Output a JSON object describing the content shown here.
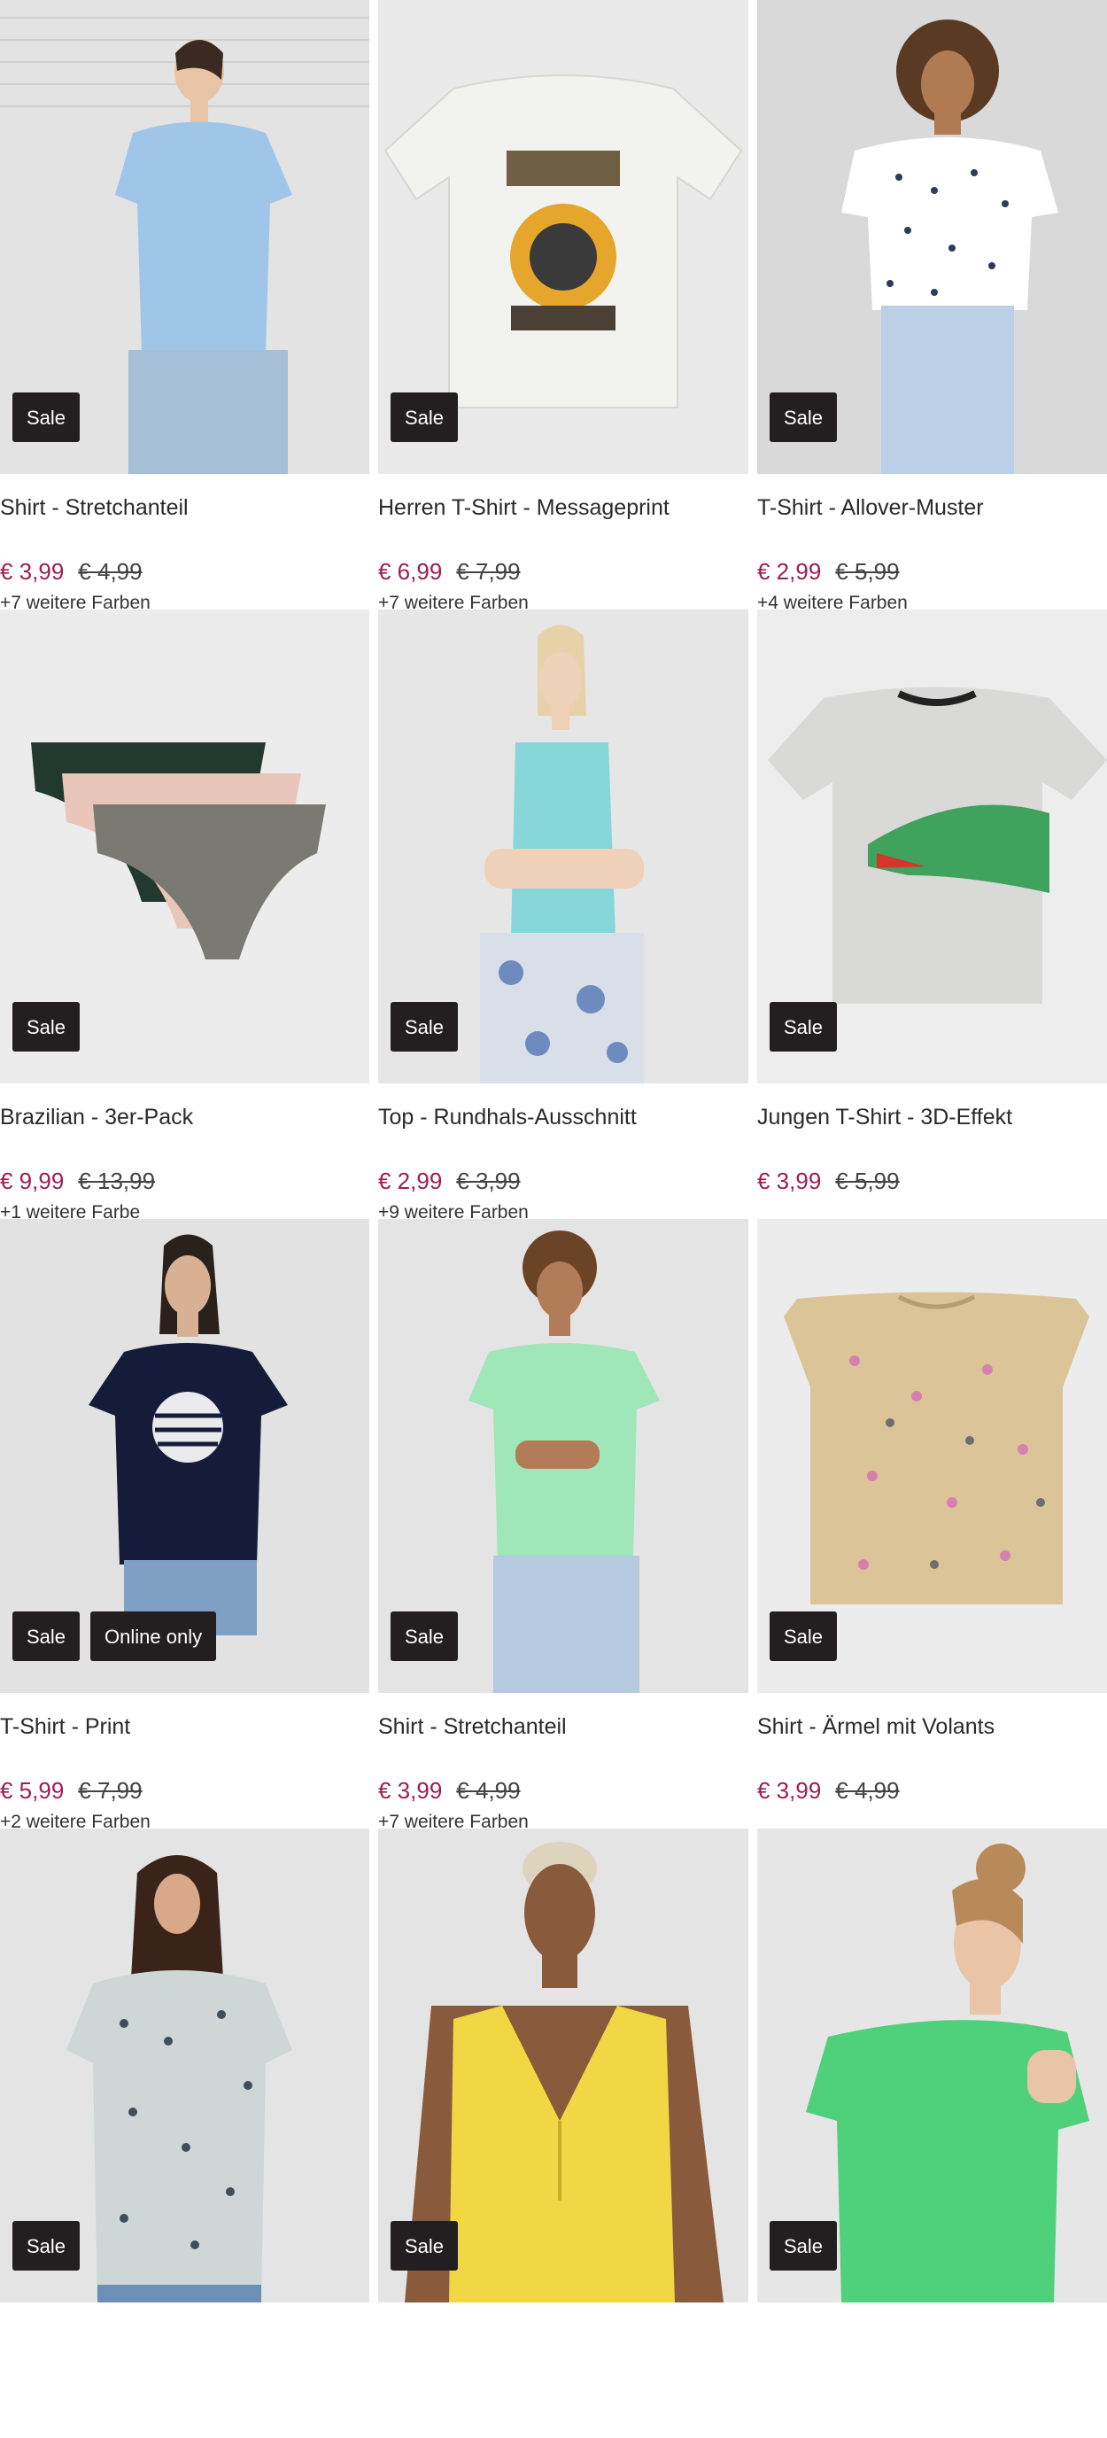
{
  "products": [
    {
      "title": "Shirt - Stretchanteil",
      "price": "€ 3,99",
      "old_price": "€ 4,99",
      "colors": "+7 weitere Farben",
      "badges": [
        "Sale"
      ]
    },
    {
      "title": "Herren T-Shirt - Messageprint",
      "price": "€ 6,99",
      "old_price": "€ 7,99",
      "colors": "+7 weitere Farben",
      "badges": [
        "Sale"
      ]
    },
    {
      "title": "T-Shirt - Allover-Muster",
      "price": "€ 2,99",
      "old_price": "€ 5,99",
      "colors": "+4 weitere Farben",
      "badges": [
        "Sale"
      ]
    },
    {
      "title": "Brazilian - 3er-Pack",
      "price": "€ 9,99",
      "old_price": "€ 13,99",
      "colors": "+1 weitere Farbe",
      "badges": [
        "Sale"
      ]
    },
    {
      "title": "Top - Rundhals-Ausschnitt",
      "price": "€ 2,99",
      "old_price": "€ 3,99",
      "colors": "+9 weitere Farben",
      "badges": [
        "Sale"
      ]
    },
    {
      "title": "Jungen T-Shirt - 3D-Effekt",
      "price": "€ 3,99",
      "old_price": "€ 5,99",
      "colors": "",
      "badges": [
        "Sale"
      ]
    },
    {
      "title": "T-Shirt - Print",
      "price": "€ 5,99",
      "old_price": "€ 7,99",
      "colors": "+2 weitere Farben",
      "badges": [
        "Sale",
        "Online only"
      ]
    },
    {
      "title": "Shirt - Stretchanteil",
      "price": "€ 3,99",
      "old_price": "€ 4,99",
      "colors": "+7 weitere Farben",
      "badges": [
        "Sale"
      ]
    },
    {
      "title": "Shirt - Ärmel mit Volants",
      "price": "€ 3,99",
      "old_price": "€ 4,99",
      "colors": "",
      "badges": [
        "Sale"
      ]
    },
    {
      "title": "",
      "price": "",
      "old_price": "",
      "colors": "",
      "badges": [
        "Sale"
      ]
    },
    {
      "title": "",
      "price": "",
      "old_price": "",
      "colors": "",
      "badges": [
        "Sale"
      ]
    },
    {
      "title": "",
      "price": "",
      "old_price": "",
      "colors": "",
      "badges": [
        "Sale"
      ]
    }
  ],
  "images": [
    {
      "icon": "woman-light-blue-shirt-photo",
      "bg": "#e3e3e3",
      "top": "#9fc6e8",
      "bottom": "#a7bfd6"
    },
    {
      "icon": "white-graphic-tshirt-photo",
      "bg": "#e9e9e9",
      "top": "#f2f2ef",
      "bottom": "#f2f2ef"
    },
    {
      "icon": "woman-patterned-white-shirt-photo",
      "bg": "#d9d9d9",
      "top": "#ffffff",
      "bottom": "#b9d0e6"
    },
    {
      "icon": "briefs-3-pack-photo",
      "bg": "#ececec",
      "top": "#21392f",
      "bottom": "#7a7a72"
    },
    {
      "icon": "woman-aqua-tank-top-photo",
      "bg": "#e6e6e6",
      "top": "#86d6da",
      "bottom": "#d9dfe9"
    },
    {
      "icon": "boys-crocodile-tshirt-photo",
      "bg": "#ededed",
      "top": "#d9d9d8",
      "bottom": "#3fa25d"
    },
    {
      "icon": "woman-navy-print-tshirt-photo",
      "bg": "#e2e2e2",
      "top": "#151c3a",
      "bottom": "#7f9fc4"
    },
    {
      "icon": "woman-mint-shirt-photo",
      "bg": "#e4e4e4",
      "top": "#9fe7b8",
      "bottom": "#b5c9df"
    },
    {
      "icon": "girls-ruffle-sleeve-tshirt-photo",
      "bg": "#ececec",
      "top": "#dcc499",
      "bottom": "#dcc499"
    },
    {
      "icon": "woman-floral-blouse-photo",
      "bg": "#e4e4e4",
      "top": "#cfd6d6",
      "bottom": "#6d8fb6"
    },
    {
      "icon": "woman-yellow-top-photo",
      "bg": "#e4e4e4",
      "top": "#f2d745",
      "bottom": "#f2d745"
    },
    {
      "icon": "woman-green-tshirt-photo",
      "bg": "#e6e6e6",
      "top": "#4fd07b",
      "bottom": "#4fd07b"
    }
  ]
}
